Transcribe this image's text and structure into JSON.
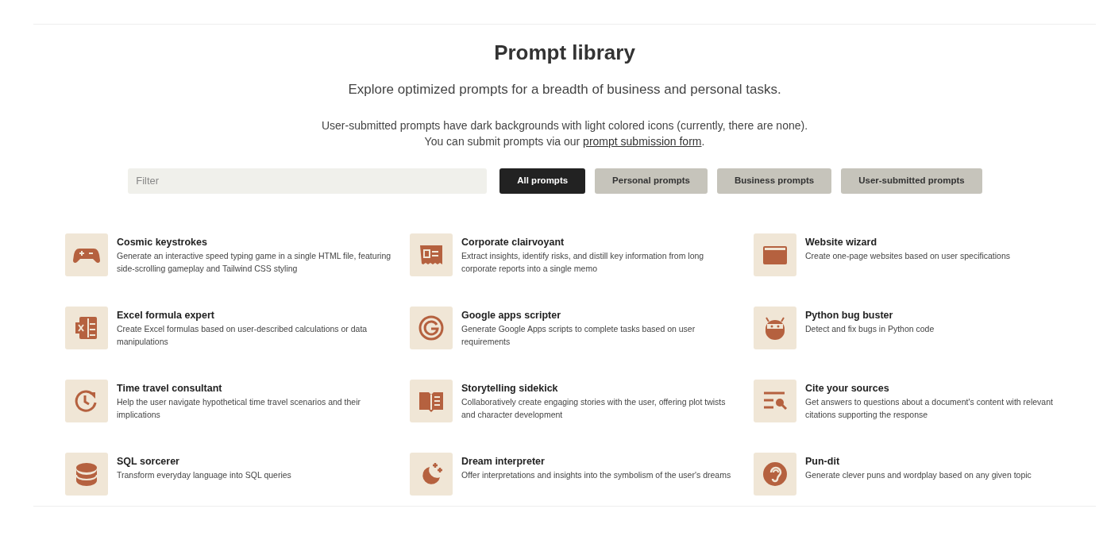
{
  "title": "Prompt library",
  "subtitle": "Explore optimized prompts for a breadth of business and personal tasks.",
  "note": {
    "line_1": "User-submitted prompts have dark backgrounds with light colored icons (currently, there are none).",
    "line_2_before": "You can submit prompts via our ",
    "line_2_link": "prompt submission form",
    "line_2_after": "."
  },
  "filter": {
    "placeholder": "Filter"
  },
  "categories": [
    {
      "label": "All prompts",
      "selected": true
    },
    {
      "label": "Personal prompts",
      "selected": false
    },
    {
      "label": "Business prompts",
      "selected": false
    },
    {
      "label": "User-submitted prompts",
      "selected": false
    }
  ],
  "prompts": [
    {
      "kind": "gamepad",
      "title": "Cosmic keystrokes",
      "description": "Generate an interactive speed typing game in a single HTML file, featuring side-scrolling gameplay and Tailwind CSS styling"
    },
    {
      "kind": "receipt",
      "title": "Corporate clairvoyant",
      "description": "Extract insights, identify risks, and distill key information from long corporate reports into a single memo"
    },
    {
      "kind": "window",
      "title": "Website wizard",
      "description": "Create one-page websites based on user specifications"
    },
    {
      "kind": "spreadsheet",
      "title": "Excel formula expert",
      "description": "Create Excel formulas based on user-described calculations or data manipulations"
    },
    {
      "kind": "letter-g",
      "title": "Google apps scripter",
      "description": "Generate Google Apps scripts to complete tasks based on user requirements"
    },
    {
      "kind": "bug",
      "title": "Python bug buster",
      "description": "Detect and fix bugs in Python code"
    },
    {
      "kind": "clock",
      "title": "Time travel consultant",
      "description": "Help the user navigate hypothetical time travel scenarios and their implications"
    },
    {
      "kind": "book",
      "title": "Storytelling sidekick",
      "description": "Collaboratively create engaging stories with the user, offering plot twists and character development"
    },
    {
      "kind": "search-lines",
      "title": "Cite your sources",
      "description": "Get answers to questions about a document's content with relevant citations supporting the response"
    },
    {
      "kind": "database",
      "title": "SQL sorcerer",
      "description": "Transform everyday language into SQL queries"
    },
    {
      "kind": "moon",
      "title": "Dream interpreter",
      "description": "Offer interpretations and insights into the symbolism of the user's dreams"
    },
    {
      "kind": "ear",
      "title": "Pun-dit",
      "description": "Generate clever puns and wordplay based on any given topic"
    }
  ]
}
